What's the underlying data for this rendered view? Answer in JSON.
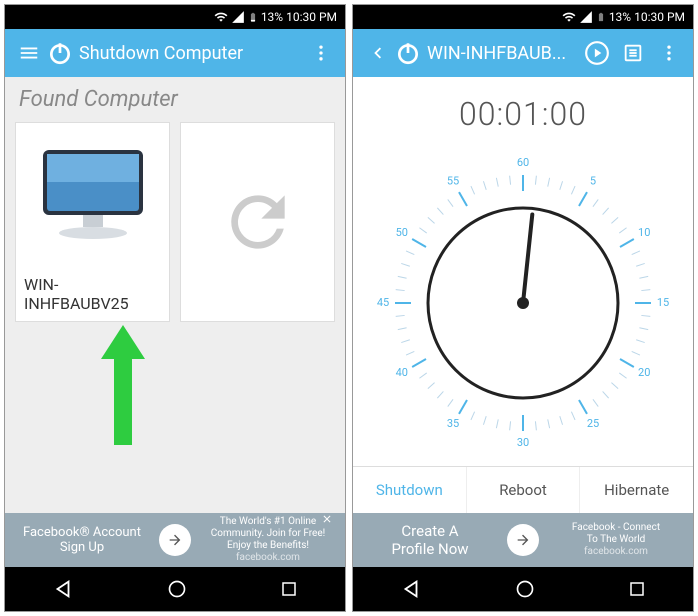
{
  "status": {
    "battery": "13%",
    "time": "10:30 PM"
  },
  "left": {
    "appbar": {
      "title": "Shutdown Computer"
    },
    "section_label": "Found Computer",
    "computer_name": "WIN-INHFBAUBV25",
    "ad": {
      "left_line1": "Facebook® Account",
      "left_line2": "Sign Up",
      "right_line1": "The World's #1 Online",
      "right_line2": "Community. Join for Free!",
      "right_line3": "Enjoy the Benefits!",
      "right_line4": "facebook.com"
    }
  },
  "right": {
    "appbar": {
      "title": "WIN-INHFBAUB..."
    },
    "timer": "00:01:00",
    "dial": {
      "ticks_major": [
        5,
        10,
        15,
        20,
        25,
        30,
        35,
        40,
        45,
        50,
        55,
        60
      ],
      "pointer_minute": 1
    },
    "tabs": {
      "t0": "Shutdown",
      "t1": "Reboot",
      "t2": "Hibernate"
    },
    "ad": {
      "left_line1": "Create A",
      "left_line2": "Profile Now",
      "right_line1": "Facebook - Connect",
      "right_line2": "To The World",
      "right_line3": "facebook.com"
    }
  }
}
